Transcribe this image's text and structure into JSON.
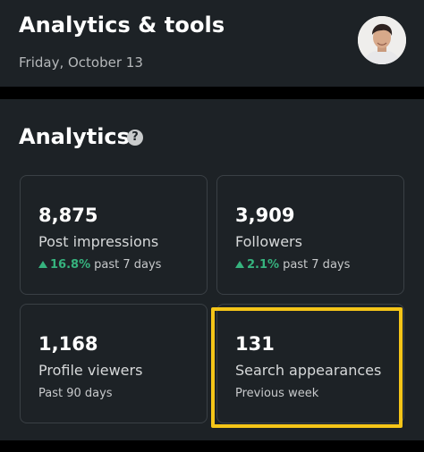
{
  "header": {
    "title": "Analytics & tools",
    "date": "Friday, October 13"
  },
  "analytics": {
    "title": "Analytics",
    "help_icon_glyph": "?",
    "cards": [
      {
        "value": "8,875",
        "label": "Post impressions",
        "trend": "16.8%",
        "period": "past 7 days"
      },
      {
        "value": "3,909",
        "label": "Followers",
        "trend": "2.1%",
        "period": "past 7 days"
      },
      {
        "value": "1,168",
        "label": "Profile viewers",
        "period": "Past 90 days"
      },
      {
        "value": "131",
        "label": "Search appearances",
        "period": "Previous week"
      }
    ]
  },
  "colors": {
    "panel": "#1d2226",
    "trend_up": "#36b37e",
    "highlight": "#f5c518"
  }
}
